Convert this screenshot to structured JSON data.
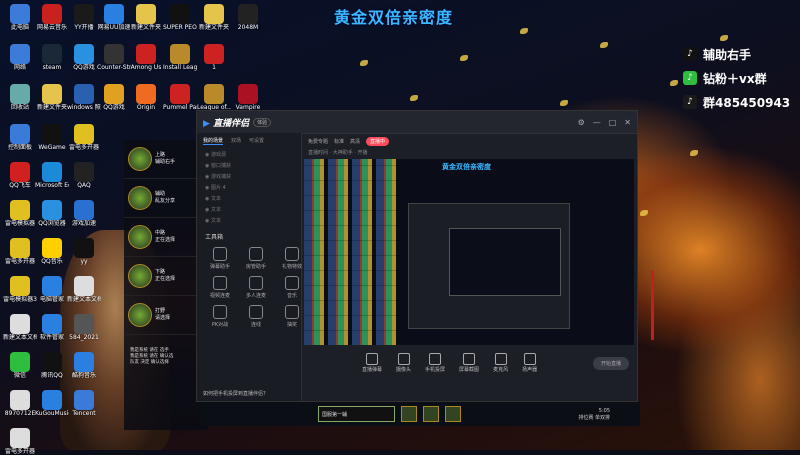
{
  "overlay_title": "黄金双倍亲密度",
  "social": [
    {
      "icon": "tiktok-icon",
      "text": "辅助右手",
      "color": "#111111"
    },
    {
      "icon": "wechat-icon",
      "text": "钻粉＋vx群",
      "color": "#2dbe3f"
    },
    {
      "icon": "qq-icon",
      "text": "群485450943",
      "color": "#1a1a1a"
    }
  ],
  "desktop_icons": [
    {
      "label": "此电脑",
      "color": "#3d7bd8"
    },
    {
      "label": "网易云音乐",
      "color": "#c92020"
    },
    {
      "label": "YY开播",
      "color": "#1a1a1a"
    },
    {
      "label": "网易UU加速",
      "color": "#2a80e0"
    },
    {
      "label": "新建文件夹",
      "color": "#e4c44a"
    },
    {
      "label": "SUPER PEOPLE CBT",
      "color": "#111"
    },
    {
      "label": "新建文件夹",
      "color": "#e4c44a"
    },
    {
      "label": "2048M",
      "color": "#222"
    },
    {
      "label": "网络",
      "color": "#3d7bd8"
    },
    {
      "label": "steam",
      "color": "#1b2838"
    },
    {
      "label": "QQ游戏",
      "color": "#2a90e0"
    },
    {
      "label": "Counter-Strike Global Off...",
      "color": "#333"
    },
    {
      "label": "Among Us",
      "color": "#c22"
    },
    {
      "label": "Install League o...",
      "color": "#b88a2a"
    },
    {
      "label": "1",
      "color": "#c22"
    },
    {
      "label": "回收站",
      "color": "#6aa"
    },
    {
      "label": "新建文件夹",
      "color": "#e4c44a"
    },
    {
      "label": "windows 照片查看器",
      "color": "#2a60b0"
    },
    {
      "label": "QQ游戏",
      "color": "#e0a020"
    },
    {
      "label": "Origin",
      "color": "#f06a20"
    },
    {
      "label": "Pummel Party",
      "color": "#c22"
    },
    {
      "label": "League of...",
      "color": "#b88a2a"
    },
    {
      "label": "Vampire",
      "color": "#a12"
    },
    {
      "label": "控制面板",
      "color": "#3a7ad8"
    },
    {
      "label": "WeGame",
      "color": "#111"
    },
    {
      "label": "雷电多开器",
      "color": "#e0c020"
    },
    {
      "label": "QQ飞车",
      "color": "#d02020"
    },
    {
      "label": "Microsoft Edge",
      "color": "#1b8ad8"
    },
    {
      "label": "QAQ",
      "color": "#222"
    },
    {
      "label": "雷电模拟器",
      "color": "#e0c020"
    },
    {
      "label": "QQ浏览器",
      "color": "#2a90e0"
    },
    {
      "label": "游戏加速",
      "color": "#2a70d0"
    },
    {
      "label": "雷电多开器",
      "color": "#e0c020"
    },
    {
      "label": "QQ音乐",
      "color": "#ffd000"
    },
    {
      "label": "yy",
      "color": "#111"
    },
    {
      "label": "雷电模拟器3",
      "color": "#e0c020"
    },
    {
      "label": "电脑管家",
      "color": "#2a80e0"
    },
    {
      "label": "新建文本文档",
      "color": "#ddd"
    },
    {
      "label": "新建文本文档",
      "color": "#ddd"
    },
    {
      "label": "软件管家",
      "color": "#2a80e0"
    },
    {
      "label": "584_2021",
      "color": "#555"
    },
    {
      "label": "微信",
      "color": "#2dbe3f"
    },
    {
      "label": "腾讯QQ",
      "color": "#111"
    },
    {
      "label": "酷狗音乐",
      "color": "#2a80e0"
    },
    {
      "label": "8970712E",
      "color": "#ddd"
    },
    {
      "label": "KuGouMusic",
      "color": "#2a80e0"
    },
    {
      "label": "Tencent",
      "color": "#3a7ad8"
    },
    {
      "label": "雷电多开器",
      "color": "#ddd"
    }
  ],
  "app": {
    "title": "直播伴侣",
    "badge": "体验",
    "left_tabs": [
      "我的场景",
      "双场",
      "可设置"
    ],
    "scenes": [
      "游戏源",
      "窗口捕获",
      "游戏捕获",
      "图片 4",
      "文本",
      "文本",
      "文本"
    ],
    "tools_title": "工具箱",
    "tools": [
      "弹幕助手",
      "房管助手",
      "礼物特效",
      "视频连麦",
      "多人连麦",
      "音乐",
      "PK对战",
      "连线",
      "抽奖"
    ],
    "footer": "如何把手机投屏到直播伴侣?",
    "top_tabs": [
      "免费专题",
      "标准",
      "高清"
    ],
    "live_label": "直播中",
    "sub_info": "直播时间 · 大神助手 · 开播",
    "bottom_tools": [
      "直播弹幕",
      "摄像头",
      "手机投屏",
      "屏幕截图",
      "麦克风",
      "扬声器"
    ],
    "go_live": "开始直播"
  },
  "preview_title": "黄金双倍亲密度",
  "game": {
    "lanes": [
      {
        "role": "上路",
        "name": "辅助右手"
      },
      {
        "role": "辅助",
        "name": "乱友分享"
      },
      {
        "role": "中路",
        "name": "正在选择"
      },
      {
        "role": "下路",
        "name": "正在选择"
      },
      {
        "role": "打野",
        "name": "请选择"
      }
    ],
    "chat": [
      "我是系统 请在 选手",
      "我是系统 请在 确认选",
      "队友 决定 确认选择"
    ],
    "select_value": "国服第一辅",
    "rank": "排位赛 单双排",
    "timer": "5:05"
  }
}
